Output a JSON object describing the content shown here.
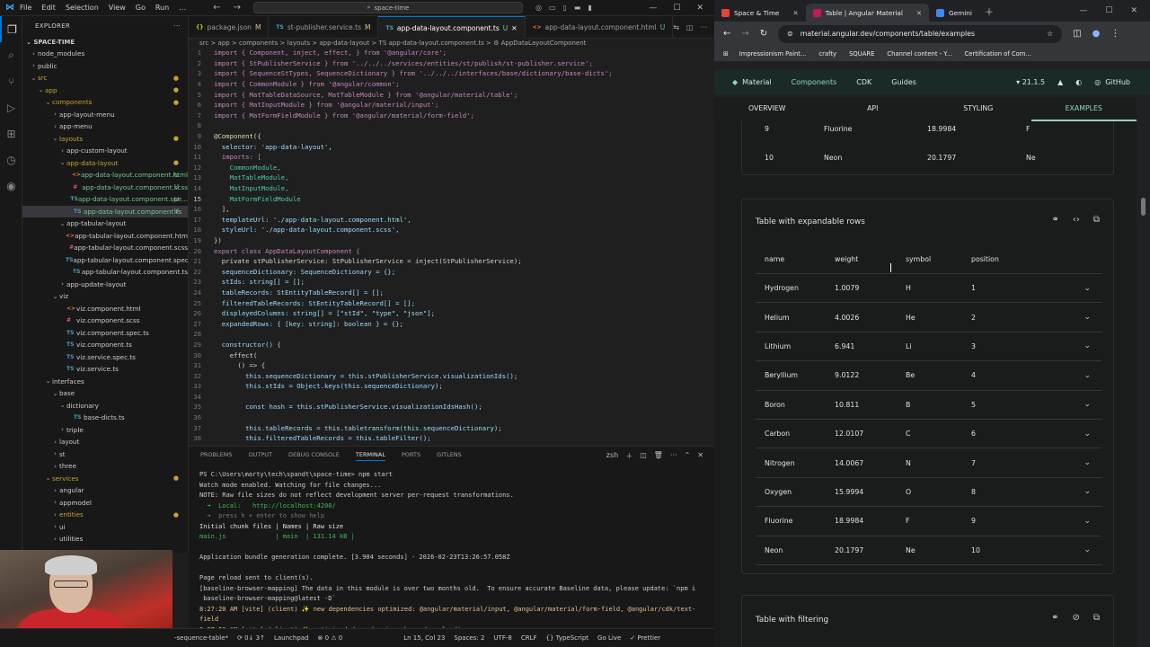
{
  "vscode": {
    "menu": [
      "File",
      "Edit",
      "Selection",
      "View",
      "Go",
      "Run",
      "…"
    ],
    "search_placeholder": "space-time",
    "explorer_title": "EXPLORER",
    "project": "SPACE-TIME",
    "tree": [
      {
        "label": "node_modules",
        "depth": 1,
        "chev": "›",
        "cls": ""
      },
      {
        "label": "public",
        "depth": 1,
        "chev": "›",
        "cls": ""
      },
      {
        "label": "src",
        "depth": 1,
        "chev": "⌄",
        "cls": "c-dot"
      },
      {
        "label": "app",
        "depth": 2,
        "chev": "⌄",
        "cls": "c-dot"
      },
      {
        "label": "components",
        "depth": 3,
        "chev": "⌄",
        "cls": "c-dot"
      },
      {
        "label": "app-layout-menu",
        "depth": 4,
        "chev": "›",
        "cls": ""
      },
      {
        "label": "app-menu",
        "depth": 4,
        "chev": "›",
        "cls": ""
      },
      {
        "label": "layouts",
        "depth": 4,
        "chev": "⌄",
        "cls": "c-dot"
      },
      {
        "label": "app-custom-layout",
        "depth": 5,
        "chev": "›",
        "cls": ""
      },
      {
        "label": "app-data-layout",
        "depth": 5,
        "chev": "⌄",
        "cls": "c-dot"
      },
      {
        "label": "app-data-layout.component.html",
        "depth": 6,
        "chev": "",
        "cls": "c-new",
        "icon": "<>",
        "badge": "U"
      },
      {
        "label": "app-data-layout.component.scss",
        "depth": 6,
        "chev": "",
        "cls": "c-new",
        "icon": "#",
        "badge": "U"
      },
      {
        "label": "app-data-layout.component.spe...",
        "depth": 6,
        "chev": "",
        "cls": "c-new",
        "icon": "TS",
        "badge": "U"
      },
      {
        "label": "app-data-layout.component.ts",
        "depth": 6,
        "chev": "",
        "cls": "c-new",
        "icon": "TS",
        "badge": "U",
        "selected": true
      },
      {
        "label": "app-tabular-layout",
        "depth": 5,
        "chev": "⌄",
        "cls": ""
      },
      {
        "label": "app-tabular-layout.component.html",
        "depth": 6,
        "chev": "",
        "cls": "",
        "icon": "<>"
      },
      {
        "label": "app-tabular-layout.component.scss",
        "depth": 6,
        "chev": "",
        "cls": "",
        "icon": "#"
      },
      {
        "label": "app-tabular-layout.component.spec.ts",
        "depth": 6,
        "chev": "",
        "cls": "",
        "icon": "TS"
      },
      {
        "label": "app-tabular-layout.component.ts",
        "depth": 6,
        "chev": "",
        "cls": "",
        "icon": "TS"
      },
      {
        "label": "app-update-layout",
        "depth": 5,
        "chev": "›",
        "cls": ""
      },
      {
        "label": "viz",
        "depth": 4,
        "chev": "⌄",
        "cls": ""
      },
      {
        "label": "viz.component.html",
        "depth": 5,
        "chev": "",
        "cls": "",
        "icon": "<>"
      },
      {
        "label": "viz.component.scss",
        "depth": 5,
        "chev": "",
        "cls": "",
        "icon": "#"
      },
      {
        "label": "viz.component.spec.ts",
        "depth": 5,
        "chev": "",
        "cls": "",
        "icon": "TS"
      },
      {
        "label": "viz.component.ts",
        "depth": 5,
        "chev": "",
        "cls": "",
        "icon": "TS"
      },
      {
        "label": "viz.service.spec.ts",
        "depth": 5,
        "chev": "",
        "cls": "",
        "icon": "TS"
      },
      {
        "label": "viz.service.ts",
        "depth": 5,
        "chev": "",
        "cls": "",
        "icon": "TS"
      },
      {
        "label": "interfaces",
        "depth": 3,
        "chev": "⌄",
        "cls": ""
      },
      {
        "label": "base",
        "depth": 4,
        "chev": "⌄",
        "cls": ""
      },
      {
        "label": "dictionary",
        "depth": 5,
        "chev": "⌄",
        "cls": ""
      },
      {
        "label": "base-dicts.ts",
        "depth": 6,
        "chev": "",
        "cls": "",
        "icon": "TS"
      },
      {
        "label": "triple",
        "depth": 5,
        "chev": "›",
        "cls": ""
      },
      {
        "label": "layout",
        "depth": 4,
        "chev": "›",
        "cls": ""
      },
      {
        "label": "st",
        "depth": 4,
        "chev": "›",
        "cls": ""
      },
      {
        "label": "three",
        "depth": 4,
        "chev": "›",
        "cls": ""
      },
      {
        "label": "services",
        "depth": 3,
        "chev": "⌄",
        "cls": "c-dot"
      },
      {
        "label": "angular",
        "depth": 4,
        "chev": "›",
        "cls": ""
      },
      {
        "label": "appmodel",
        "depth": 4,
        "chev": "›",
        "cls": ""
      },
      {
        "label": "entities",
        "depth": 4,
        "chev": "›",
        "cls": "c-dot"
      },
      {
        "label": "ui",
        "depth": 4,
        "chev": "›",
        "cls": ""
      },
      {
        "label": "utilities",
        "depth": 4,
        "chev": "›",
        "cls": ""
      }
    ],
    "tabs": [
      {
        "label": "package.json",
        "icon": "{}",
        "kind": "json",
        "status": "M",
        "active": false
      },
      {
        "label": "st-publisher.service.ts",
        "icon": "TS",
        "kind": "ts",
        "status": "M",
        "active": false
      },
      {
        "label": "app-data-layout.component.ts",
        "icon": "TS",
        "kind": "ts",
        "status": "U",
        "active": true
      },
      {
        "label": "app-data-layout.component.html",
        "icon": "<>",
        "kind": "html",
        "status": "U",
        "active": false
      }
    ],
    "breadcrumbs": "src > app > components > layouts > app-data-layout > TS app-data-layout.component.ts > ⚙ AppDataLayoutComponent",
    "code_lines": [
      {
        "n": "1",
        "t": "import { Component, inject, effect, } from '@angular/core';"
      },
      {
        "n": "2",
        "t": "import { StPublisherService } from '../../../services/entities/st/publish/st-publisher.service';"
      },
      {
        "n": "3",
        "t": "import { SequenceStTypes, SequenceDictionary } from '../../../interfaces/base/dictionary/base-dicts';"
      },
      {
        "n": "4",
        "t": "import { CommonModule } from '@angular/common';"
      },
      {
        "n": "5",
        "t": "import { MatTableDataSource, MatTableModule } from '@angular/material/table';"
      },
      {
        "n": "6",
        "t": "import { MatInputModule } from '@angular/material/input';"
      },
      {
        "n": "7",
        "t": "import { MatFormFieldModule } from '@angular/material/form-field';"
      },
      {
        "n": "8",
        "t": ""
      },
      {
        "n": "9",
        "t": "@Component({"
      },
      {
        "n": "10",
        "t": "  selector: 'app-data-layout',"
      },
      {
        "n": "11",
        "t": "  imports: ["
      },
      {
        "n": "12",
        "t": "    CommonModule,"
      },
      {
        "n": "13",
        "t": "    MatTableModule,"
      },
      {
        "n": "14",
        "t": "    MatInputModule,"
      },
      {
        "n": "15",
        "t": "    MatFormFieldModule"
      },
      {
        "n": "16",
        "t": "  ],"
      },
      {
        "n": "17",
        "t": "  templateUrl: './app-data-layout.component.html',"
      },
      {
        "n": "18",
        "t": "  styleUrl: './app-data-layout.component.scss',"
      },
      {
        "n": "19",
        "t": "})"
      },
      {
        "n": "20",
        "t": "export class AppDataLayoutComponent {"
      },
      {
        "n": "21",
        "t": "  private stPublisherService: StPublisherService = inject(StPublisherService);"
      },
      {
        "n": "22",
        "t": "  sequenceDictionary: SequenceDictionary = {};"
      },
      {
        "n": "23",
        "t": "  stIds: string[] = [];"
      },
      {
        "n": "24",
        "t": "  tableRecords: StEntityTableRecord[] = [];"
      },
      {
        "n": "25",
        "t": "  filteredTableRecords: StEntityTableRecord[] = [];"
      },
      {
        "n": "26",
        "t": "  displayedColumns: string[] = [\"stId\", \"type\", \"json\"];"
      },
      {
        "n": "27",
        "t": "  expandedRows: { [key: string]: boolean } = {};"
      },
      {
        "n": "28",
        "t": ""
      },
      {
        "n": "29",
        "t": "  constructor() {"
      },
      {
        "n": "30",
        "t": "    effect("
      },
      {
        "n": "31",
        "t": "      () => {"
      },
      {
        "n": "32",
        "t": "        this.sequenceDictionary = this.stPublisherService.visualizationIds();"
      },
      {
        "n": "33",
        "t": "        this.stIds = Object.keys(this.sequenceDictionary);"
      },
      {
        "n": "34",
        "t": ""
      },
      {
        "n": "35",
        "t": "        const hash = this.stPublisherService.visualizationIdsHash();"
      },
      {
        "n": "36",
        "t": ""
      },
      {
        "n": "37",
        "t": "        this.tableRecords = this.tabletransform(this.sequenceDictionary);"
      },
      {
        "n": "38",
        "t": "        this.filteredTableRecords = this.tableFilter();"
      }
    ],
    "panel_tabs": [
      "PROBLEMS",
      "OUTPUT",
      "DEBUG CONSOLE",
      "TERMINAL",
      "PORTS",
      "GITLENS"
    ],
    "terminal_shell": "zsh",
    "terminal_lines": [
      {
        "t": "PS C:\\Users\\marty\\tech\\spandt\\space-time> npm start",
        "c": "#cccccc"
      },
      {
        "t": "Watch mode enabled. Watching for file changes...",
        "c": "#cccccc"
      },
      {
        "t": "NOTE: Raw file sizes do not reflect development server per-request transformations.",
        "c": "#cccccc"
      },
      {
        "t": "  ➜  Local:   http://localhost:4200/",
        "c": "#3fb950"
      },
      {
        "t": "  ➜  press h + enter to show help",
        "c": "#6e7681"
      },
      {
        "t": "Initial chunk files | Names | Raw size",
        "c": "#e0e0e0"
      },
      {
        "t": "main.js             | main  | 131.14 kB |",
        "c": "#3fb950"
      },
      {
        "t": "",
        "c": "#cccccc"
      },
      {
        "t": "Application bundle generation complete. [3.904 seconds] - 2026-02-23T13:26:57.058Z",
        "c": "#cccccc"
      },
      {
        "t": "",
        "c": "#cccccc"
      },
      {
        "t": "Page reload sent to client(s).",
        "c": "#cccccc"
      },
      {
        "t": "[baseline-browser-mapping] The data in this module is over two months old.  To ensure accurate Baseline data, please update: `npm i",
        "c": "#cccccc"
      },
      {
        "t": " baseline-browser-mapping@latest -D`",
        "c": "#cccccc"
      },
      {
        "t": "8:27:20 AM [vite] (client) ✨ new dependencies optimized: @angular/material/input, @angular/material/form-field, @angular/cdk/text-",
        "c": "#e2c08d"
      },
      {
        "t": "field",
        "c": "#e2c08d"
      },
      {
        "t": "8:27:20 AM [vite] (client) ✨ optimized dependencies changed. reloading",
        "c": "#e2c08d"
      }
    ],
    "status": {
      "branch": "-sequence-table*",
      "sync": "⟳ 0↓ 3↑",
      "launchpad": "Launchpad",
      "problems": "⊗ 0 ⚠ 0",
      "cursor": "Ln 15, Col 23",
      "spaces": "Spaces: 2",
      "encoding": "UTF-8",
      "eol": "CRLF",
      "lang": "{} TypeScript",
      "golive": "Go Live",
      "prettier": "✓ Prettier"
    }
  },
  "browser": {
    "tabs": [
      {
        "label": "Space & Time",
        "active": false,
        "color": "#e8403a"
      },
      {
        "label": "Table | Angular Material",
        "active": true,
        "color": "#c2185b"
      },
      {
        "label": "Gemini",
        "active": false,
        "color": "#4285f4"
      }
    ],
    "url": "material.angular.dev/components/table/examples",
    "bookmarks": [
      "Impressionism Paint...",
      "crafty",
      "SQUARE",
      "Channel content - Y...",
      "Certification of Com..."
    ],
    "ng_nav": {
      "brand": "Material",
      "components": "Components",
      "cdk": "CDK",
      "guides": "Guides",
      "version": "21.1.5",
      "github": "GitHub"
    },
    "page_tabs": [
      "OVERVIEW",
      "API",
      "STYLING",
      "EXAMPLES"
    ],
    "prev_rows": [
      {
        "pos": "9",
        "name": "Fluorine",
        "weight": "18.9984",
        "symbol": "F"
      },
      {
        "pos": "10",
        "name": "Neon",
        "weight": "20.1797",
        "symbol": "Ne"
      }
    ],
    "expandable": {
      "title": "Table with expandable rows",
      "headers": {
        "name": "name",
        "weight": "weight",
        "symbol": "symbol",
        "position": "position"
      },
      "rows": [
        {
          "name": "Hydrogen",
          "weight": "1.0079",
          "symbol": "H",
          "position": "1"
        },
        {
          "name": "Helium",
          "weight": "4.0026",
          "symbol": "He",
          "position": "2"
        },
        {
          "name": "Lithium",
          "weight": "6.941",
          "symbol": "Li",
          "position": "3"
        },
        {
          "name": "Beryllium",
          "weight": "9.0122",
          "symbol": "Be",
          "position": "4"
        },
        {
          "name": "Boron",
          "weight": "10.811",
          "symbol": "B",
          "position": "5"
        },
        {
          "name": "Carbon",
          "weight": "12.0107",
          "symbol": "C",
          "position": "6"
        },
        {
          "name": "Nitrogen",
          "weight": "14.0067",
          "symbol": "N",
          "position": "7"
        },
        {
          "name": "Oxygen",
          "weight": "15.9994",
          "symbol": "O",
          "position": "8"
        },
        {
          "name": "Fluorine",
          "weight": "18.9984",
          "symbol": "F",
          "position": "9"
        },
        {
          "name": "Neon",
          "weight": "20.1797",
          "symbol": "Ne",
          "position": "10"
        }
      ]
    },
    "filtering": {
      "title": "Table with filtering"
    }
  }
}
